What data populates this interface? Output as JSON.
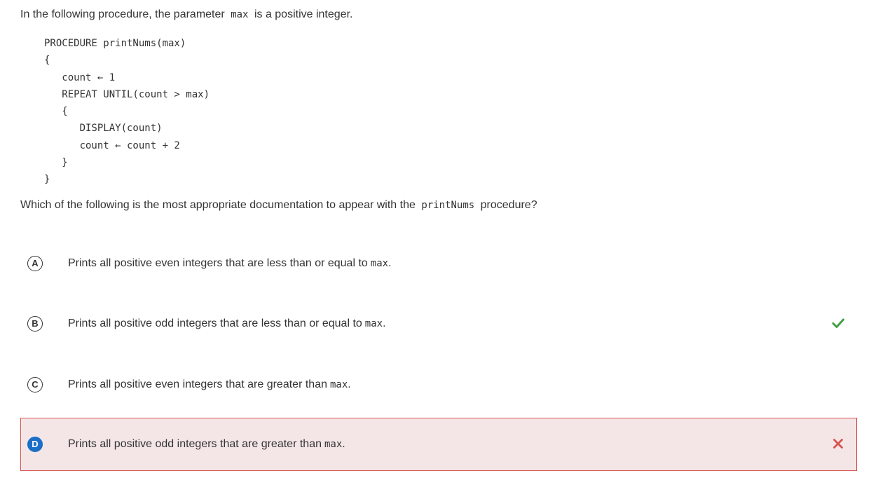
{
  "prompt": {
    "before": "In the following procedure, the parameter",
    "param": "max",
    "after": "is a positive integer."
  },
  "code": {
    "lines": [
      "PROCEDURE printNums(max)",
      "{",
      "   count ← 1",
      "   REPEAT UNTIL(count > max)",
      "   {",
      "      DISPLAY(count)",
      "      count ← count + 2",
      "   }",
      "}"
    ]
  },
  "question": {
    "before": "Which of the following is the most appropriate documentation to appear with the",
    "proc": "printNums",
    "after": "procedure?"
  },
  "choices": [
    {
      "letter": "A",
      "text": "Prints all positive even integers that are less than or equal to",
      "code": "max",
      "suffix": ".",
      "status": "none",
      "selected": false
    },
    {
      "letter": "B",
      "text": "Prints all positive odd integers that are less than or equal to",
      "code": "max",
      "suffix": ".",
      "status": "correct",
      "selected": false
    },
    {
      "letter": "C",
      "text": "Prints all positive even integers that are greater than",
      "code": "max",
      "suffix": ".",
      "status": "none",
      "selected": false
    },
    {
      "letter": "D",
      "text": "Prints all positive odd integers that are greater than",
      "code": "max",
      "suffix": ".",
      "status": "incorrect",
      "selected": true
    }
  ],
  "icons": {
    "correct": "checkmark-icon",
    "incorrect": "x-mark-icon"
  },
  "colors": {
    "correct": "#43a047",
    "incorrect": "#d9534f",
    "selected_badge": "#1c6fc7",
    "incorrect_background": "#f4e6e7"
  }
}
